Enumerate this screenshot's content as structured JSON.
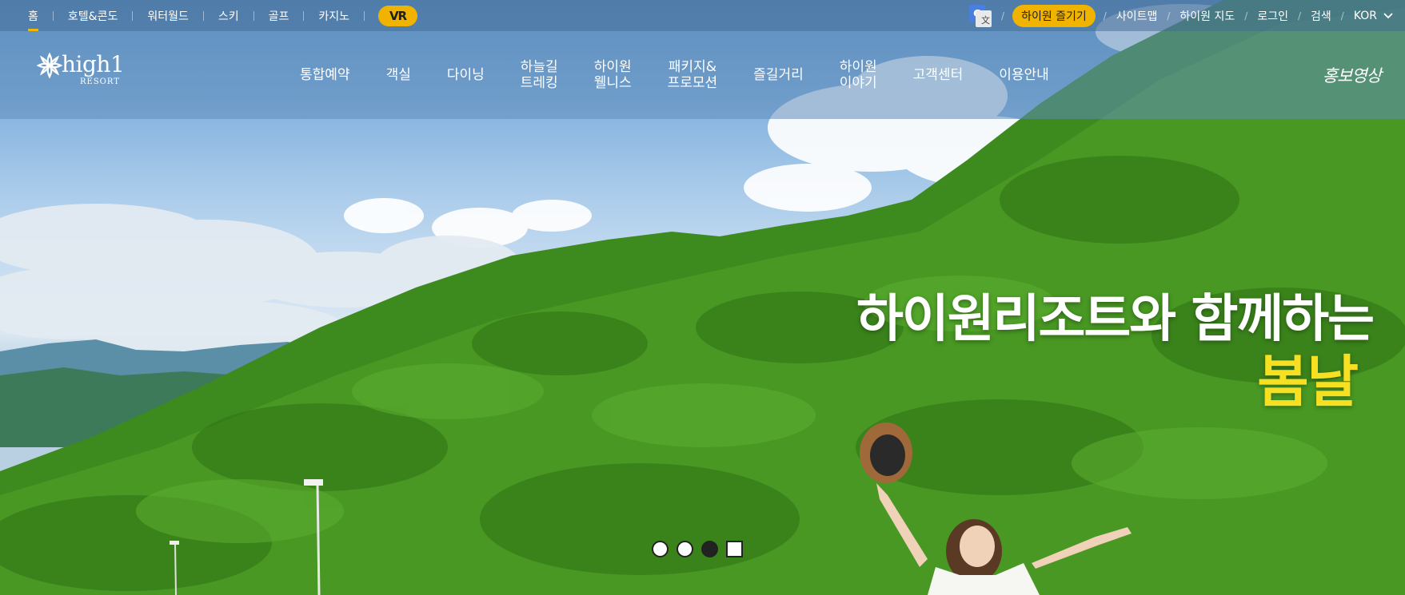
{
  "topbar": {
    "tabs": [
      {
        "label": "홈",
        "active": true
      },
      {
        "label": "호텔&콘도"
      },
      {
        "label": "워터월드"
      },
      {
        "label": "스키"
      },
      {
        "label": "골프"
      },
      {
        "label": "카지노"
      }
    ],
    "vr_label": "VR",
    "translate_icon": "google-translate-icon",
    "enjoy_label": "하이원 즐기기",
    "utils": [
      "사이트맵",
      "하이원 지도",
      "로그인",
      "검색"
    ],
    "language": "KOR"
  },
  "nav": {
    "logo_word": "high1",
    "logo_sub": "RESORT",
    "menu": [
      "통합예약",
      "객실",
      "다이닝",
      "하늘길\n트레킹",
      "하이원\n웰니스",
      "패키지&\n프로모션",
      "즐길거리",
      "하이원\n이야기",
      "고객센터",
      "이용안내"
    ],
    "promo_video": "홍보영상"
  },
  "hero": {
    "line1": "하이원리조트와 함께하는",
    "line2": "봄날"
  },
  "slider": {
    "dots": [
      "slide-1",
      "slide-2",
      "slide-3"
    ],
    "active_index": 2,
    "pause_label": "pause"
  },
  "colors": {
    "accent": "#f0b400",
    "headline_accent": "#f7e022",
    "forest": "#3f8a20"
  }
}
